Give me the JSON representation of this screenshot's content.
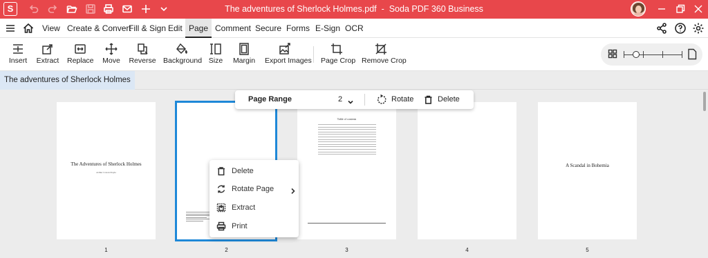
{
  "app": {
    "logo_letter": "S",
    "title_file": "The adventures of Sherlock Holmes.pdf",
    "title_separator": "-",
    "title_app": "Soda PDF 360 Business",
    "accent_color": "#e8474b",
    "selection_color": "#1e88d8"
  },
  "titlebar_icons": [
    "undo-icon",
    "redo-icon",
    "folder-open-icon",
    "save-icon",
    "print-icon",
    "mail-icon",
    "plus-icon",
    "chevron-down-icon"
  ],
  "menu": {
    "items": [
      "View",
      "Create & Convert",
      "Fill & Sign",
      "Edit",
      "Page",
      "Comment",
      "Secure",
      "Forms",
      "E-Sign",
      "OCR"
    ],
    "active": "Page"
  },
  "toolbar": {
    "tools": [
      "Insert",
      "Extract",
      "Replace",
      "Move",
      "Reverse",
      "Background",
      "Size",
      "Margin",
      "Export Images",
      "Page Crop",
      "Remove Crop"
    ]
  },
  "document_tab": {
    "label": "The adventures of Sherlock Holmes"
  },
  "range_bar": {
    "label": "Page Range",
    "value": "2",
    "rotate_label": "Rotate",
    "delete_label": "Delete"
  },
  "pages": [
    {
      "number": "1",
      "title": "The Adventures of Sherlock Holmes",
      "subtitle": "Arthur Conan Doyle"
    },
    {
      "number": "2",
      "selected": true
    },
    {
      "number": "3",
      "title": "Table of contents"
    },
    {
      "number": "4"
    },
    {
      "number": "5",
      "title": "A Scandal in Bohemia"
    }
  ],
  "context_menu": {
    "items": [
      "Delete",
      "Rotate Page",
      "Extract",
      "Print"
    ]
  }
}
